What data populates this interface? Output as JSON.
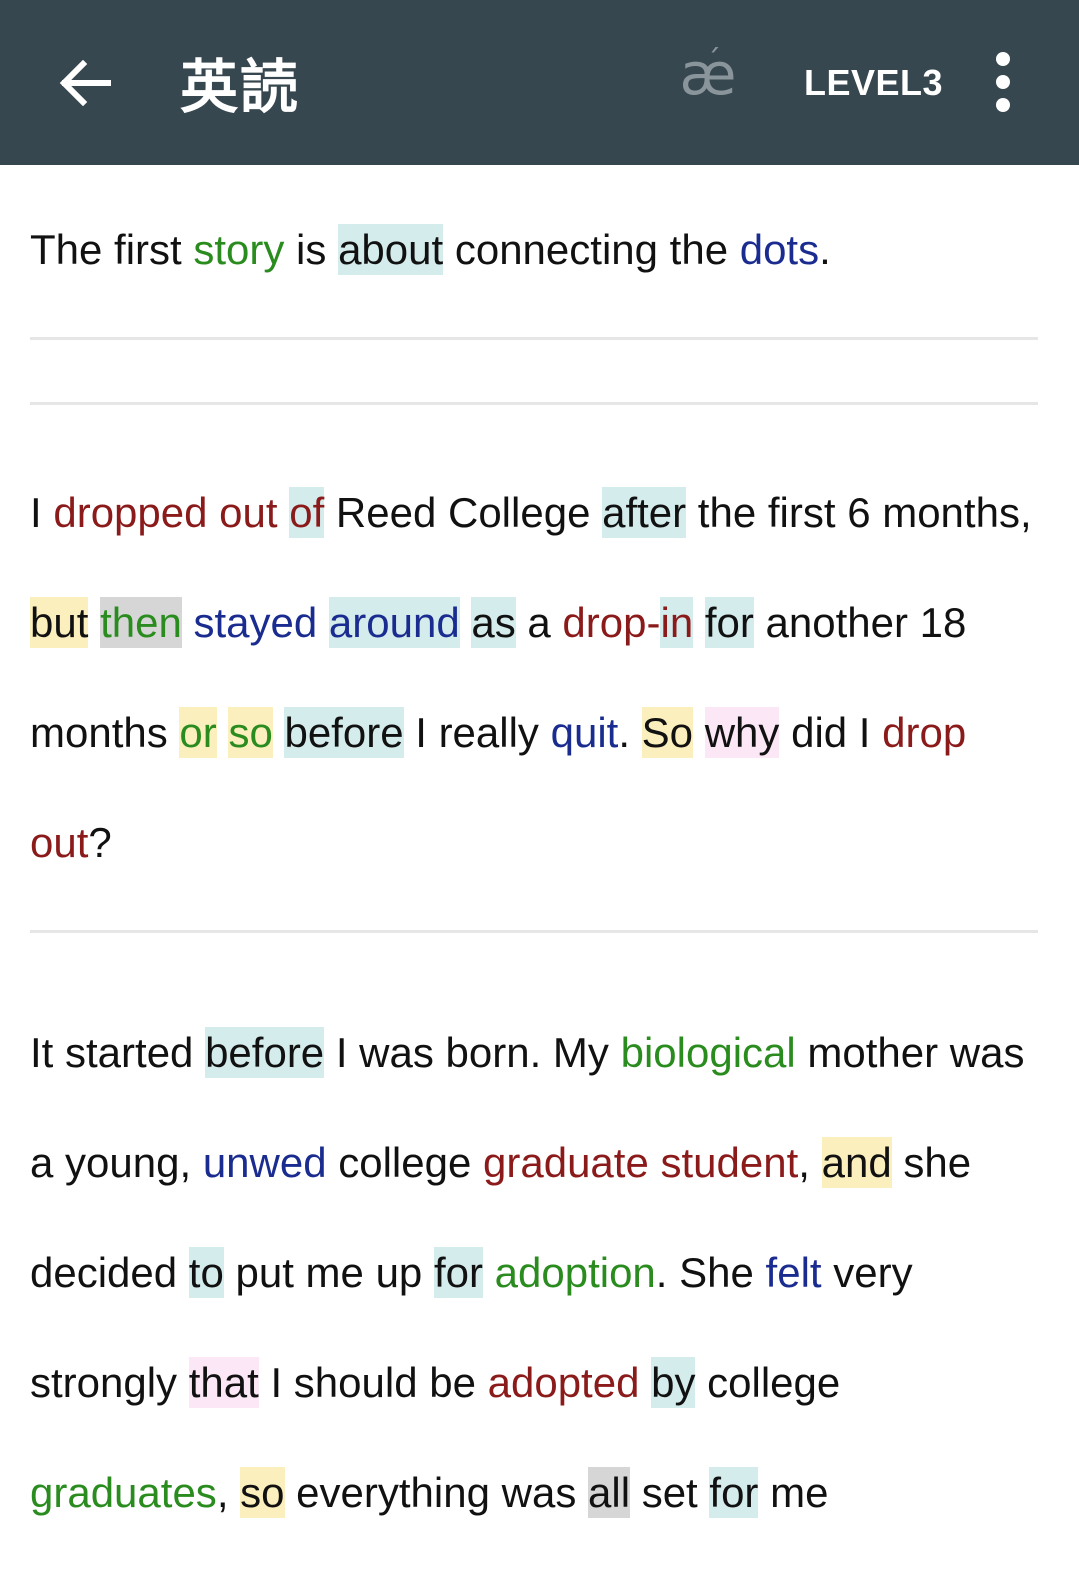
{
  "app_bar": {
    "title": "英読",
    "pronunciation_symbol": "æ",
    "pronunciation_accent": "ˊ",
    "level": "LEVEL3",
    "background_color": "#37474f"
  },
  "legend_colors": {
    "red": "#8b1a1a",
    "green": "#2a8c1e",
    "blue": "#1a2c8f",
    "highlight_cyan": "#d5ecec",
    "highlight_yellow": "#fcefbe",
    "highlight_gray": "#d6d6d6",
    "highlight_pink": "#fbe7f6"
  },
  "paragraphs": [
    {
      "words": [
        {
          "t": "The first "
        },
        {
          "t": "story",
          "c": "green"
        },
        {
          "t": " is "
        },
        {
          "t": "about",
          "h": "cyan"
        },
        {
          "t": " connecting the "
        },
        {
          "t": "dots",
          "c": "blue"
        },
        {
          "t": "."
        }
      ]
    },
    {
      "words": []
    },
    {
      "words": [
        {
          "t": "I "
        },
        {
          "t": "dropped out",
          "c": "red"
        },
        {
          "t": " "
        },
        {
          "t": "of",
          "c": "red",
          "h": "cyan"
        },
        {
          "t": " Reed College "
        },
        {
          "t": "after",
          "h": "cyan"
        },
        {
          "t": " the first 6 months, "
        },
        {
          "t": "but",
          "h": "yellow"
        },
        {
          "t": " "
        },
        {
          "t": "then",
          "c": "green",
          "h": "gray"
        },
        {
          "t": " "
        },
        {
          "t": "stayed",
          "c": "blue"
        },
        {
          "t": " "
        },
        {
          "t": "around",
          "c": "blue",
          "h": "cyan"
        },
        {
          "t": " "
        },
        {
          "t": "as",
          "h": "cyan"
        },
        {
          "t": " a "
        },
        {
          "t": "drop-",
          "c": "red"
        },
        {
          "t": "in",
          "c": "red",
          "h": "cyan"
        },
        {
          "t": " "
        },
        {
          "t": "for",
          "h": "cyan"
        },
        {
          "t": " another 18 months "
        },
        {
          "t": "or",
          "c": "green",
          "h": "yellow"
        },
        {
          "t": " "
        },
        {
          "t": "so",
          "c": "green",
          "h": "yellow"
        },
        {
          "t": " "
        },
        {
          "t": "before",
          "h": "cyan"
        },
        {
          "t": " I really "
        },
        {
          "t": "quit",
          "c": "blue"
        },
        {
          "t": ". "
        },
        {
          "t": "So",
          "h": "yellow"
        },
        {
          "t": " "
        },
        {
          "t": "why",
          "h": "pink"
        },
        {
          "t": " did I "
        },
        {
          "t": "drop out",
          "c": "red"
        },
        {
          "t": "?"
        }
      ]
    },
    {
      "words": [
        {
          "t": "It started "
        },
        {
          "t": "before",
          "h": "cyan"
        },
        {
          "t": " I was born. My "
        },
        {
          "t": "biological",
          "c": "green"
        },
        {
          "t": " mother was a young, "
        },
        {
          "t": "unwed",
          "c": "blue"
        },
        {
          "t": " college "
        },
        {
          "t": "graduate student",
          "c": "red"
        },
        {
          "t": ", "
        },
        {
          "t": "and",
          "h": "yellow"
        },
        {
          "t": " she decided "
        },
        {
          "t": "to",
          "h": "cyan"
        },
        {
          "t": " put me up "
        },
        {
          "t": "for",
          "h": "cyan"
        },
        {
          "t": " "
        },
        {
          "t": "adoption",
          "c": "green"
        },
        {
          "t": ". She "
        },
        {
          "t": "felt",
          "c": "blue"
        },
        {
          "t": " very strongly "
        },
        {
          "t": "that",
          "h": "pink"
        },
        {
          "t": " I should be "
        },
        {
          "t": "adopted",
          "c": "red"
        },
        {
          "t": " "
        },
        {
          "t": "by",
          "h": "cyan"
        },
        {
          "t": " college "
        },
        {
          "t": "graduates",
          "c": "green"
        },
        {
          "t": ", "
        },
        {
          "t": "so",
          "h": "yellow"
        },
        {
          "t": " everything was "
        },
        {
          "t": "all",
          "h": "gray"
        },
        {
          "t": " set "
        },
        {
          "t": "for",
          "h": "cyan"
        },
        {
          "t": " me"
        }
      ]
    }
  ]
}
